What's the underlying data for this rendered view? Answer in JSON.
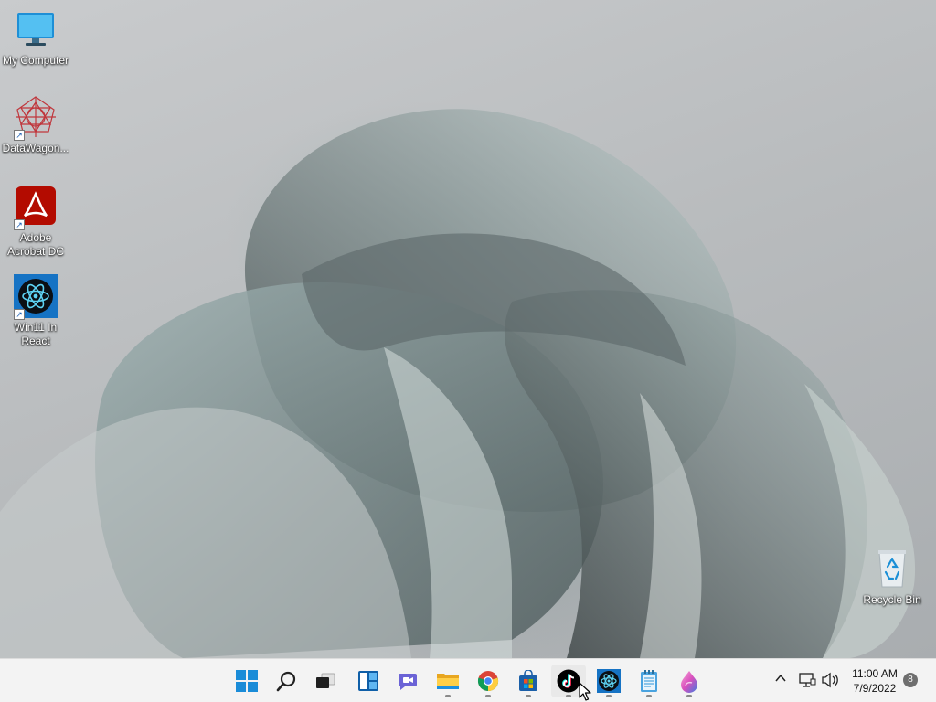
{
  "desktop": {
    "icons": [
      {
        "label": "My Computer"
      },
      {
        "label": "DataWagon..."
      },
      {
        "label": "Adobe Acrobat DC"
      },
      {
        "label": "Win11 In React"
      },
      {
        "label": "Recycle Bin"
      }
    ]
  },
  "taskbar": {
    "apps": [
      {
        "icon": "windows-start-icon"
      },
      {
        "icon": "search-icon"
      },
      {
        "icon": "task-view-icon"
      },
      {
        "icon": "widgets-icon"
      },
      {
        "icon": "teams-chat-icon"
      },
      {
        "icon": "file-explorer-icon"
      },
      {
        "icon": "chrome-icon"
      },
      {
        "icon": "microsoft-store-icon"
      },
      {
        "icon": "tiktok-icon"
      },
      {
        "icon": "react-app-icon"
      },
      {
        "icon": "notepad-icon"
      },
      {
        "icon": "paint-icon"
      }
    ],
    "tray": {
      "time": "11:00 AM",
      "date": "7/9/2022",
      "notification_count": "8"
    }
  }
}
